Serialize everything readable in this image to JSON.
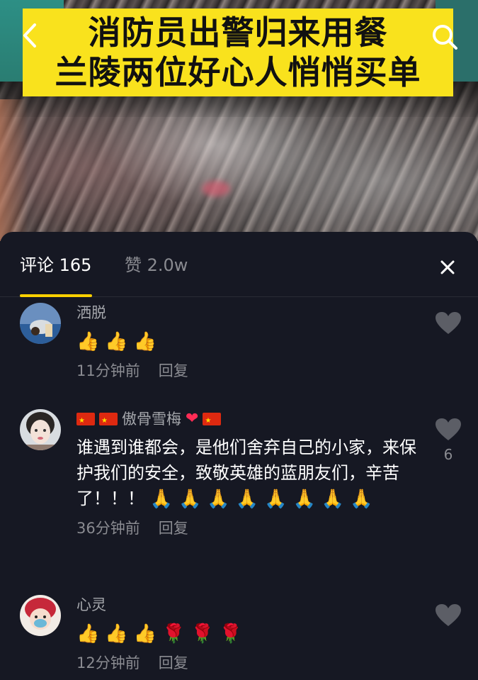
{
  "video": {
    "banner_line1": "消防员出警归来用餐",
    "banner_line2": "兰陵两位好心人悄悄买单"
  },
  "icons": {
    "back": "chevron-left-icon",
    "search": "search-icon",
    "close": "close-icon",
    "like": "heart-icon"
  },
  "colors": {
    "banner_bg": "#f9e21d",
    "sheet_bg": "#161823",
    "accent_underline": "#fbd000",
    "muted_text": "#8a8b91"
  },
  "sheet": {
    "tab_comments": "评论 165",
    "tab_likes": "赞 2.0w"
  },
  "comments": [
    {
      "username": "洒脱",
      "text": "👍👍👍",
      "time": "11分钟前",
      "reply": "回复",
      "likes": ""
    },
    {
      "username": "🇨🇳🇨🇳傲骨雪梅❤️🇨🇳",
      "username_text": "傲骨雪梅",
      "text": "谁遇到谁都会，是他们舍弃自己的小家，来保护我们的安全，致敬英雄的蓝朋友们，辛苦了！！！🙏🙏🙏🙏🙏🙏🙏🙏",
      "text_plain": "谁遇到谁都会，是他们舍弃自己的小家，来保护我们的安全，致敬英雄的蓝朋友们，辛苦了！！！",
      "time": "36分钟前",
      "reply": "回复",
      "likes": "6"
    },
    {
      "username": "心灵",
      "text": "👍👍👍🌹🌹🌹",
      "time": "12分钟前",
      "reply": "回复",
      "likes": ""
    }
  ]
}
